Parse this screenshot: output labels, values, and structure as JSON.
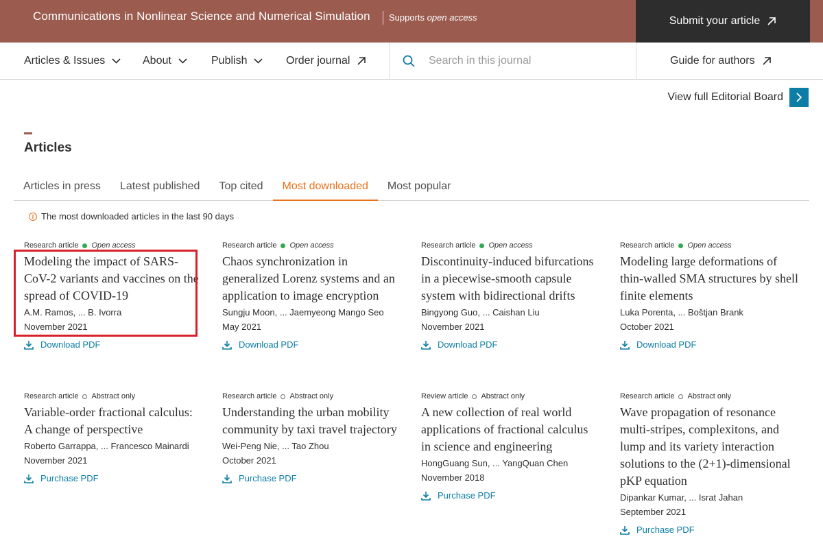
{
  "header": {
    "journal_title": "Communications in Nonlinear Science and Numerical Simulation",
    "supports_prefix": "Supports ",
    "open_access": "open access",
    "submit_label": "Submit your article"
  },
  "nav": {
    "articles_issues": "Articles & Issues",
    "about": "About",
    "publish": "Publish",
    "order_journal": "Order journal",
    "search_placeholder": "Search in this journal",
    "guide_for_authors": "Guide for authors"
  },
  "editorial_board": "View full Editorial Board",
  "section_title": "Articles",
  "tabs": [
    "Articles in press",
    "Latest published",
    "Top cited",
    "Most downloaded",
    "Most popular"
  ],
  "active_tab": "Most downloaded",
  "info_text": "The most downloaded articles in the last 90 days",
  "articles": [
    {
      "type": "Research article",
      "access": "Open access",
      "title": "Modeling the impact of SARS-CoV-2 variants and vaccines on the spread of COVID-19",
      "authors": "A.M. Ramos, ... B. Ivorra",
      "date": "November 2021",
      "action": "Download PDF"
    },
    {
      "type": "Research article",
      "access": "Open access",
      "title": "Chaos synchronization in generalized Lorenz systems and an application to image encryption",
      "authors": "Sungju Moon, ... Jaemyeong Mango Seo",
      "date": "May 2021",
      "action": "Download PDF"
    },
    {
      "type": "Research article",
      "access": "Open access",
      "title": "Discontinuity-induced bifurcations in a piecewise-smooth capsule system with bidirectional drifts",
      "authors": "Bingyong Guo, ... Caishan Liu",
      "date": "November 2021",
      "action": "Download PDF"
    },
    {
      "type": "Research article",
      "access": "Open access",
      "title": "Modeling large deformations of thin-walled SMA structures by shell finite elements",
      "authors": "Luka Porenta, ... Boštjan Brank",
      "date": "October 2021",
      "action": "Download PDF"
    },
    {
      "type": "Research article",
      "access": "Abstract only",
      "title": "Variable-order fractional calculus: A change of perspective",
      "authors": "Roberto Garrappa, ... Francesco Mainardi",
      "date": "November 2021",
      "action": "Purchase PDF"
    },
    {
      "type": "Research article",
      "access": "Abstract only",
      "title": "Understanding the urban mobility community by taxi travel trajectory",
      "authors": "Wei-Peng Nie, ... Tao Zhou",
      "date": "October 2021",
      "action": "Purchase PDF"
    },
    {
      "type": "Review article",
      "access": "Abstract only",
      "title": "A new collection of real world applications of fractional calculus in science and engineering",
      "authors": "HongGuang Sun, ... YangQuan Chen",
      "date": "November 2018",
      "action": "Purchase PDF"
    },
    {
      "type": "Research article",
      "access": "Abstract only",
      "title": "Wave propagation of resonance multi-stripes, complexitons, and lump and its variety interaction solutions to the (2+1)-dimensional pKP equation",
      "authors": "Dipankar Kumar, ... Israt Jahan",
      "date": "September 2021",
      "action": "Purchase PDF"
    }
  ],
  "colors": {
    "brand": "#9b5b4f",
    "accent": "#e9711c",
    "link": "#0c7da5",
    "open_access_dot": "#35a853",
    "highlight": "#d8202a"
  },
  "icons": {
    "dropdown": "chevron-down-icon",
    "external": "arrow-up-right-icon",
    "search": "search-icon",
    "board": "chevron-right-icon",
    "info": "info-icon",
    "download": "download-icon"
  }
}
